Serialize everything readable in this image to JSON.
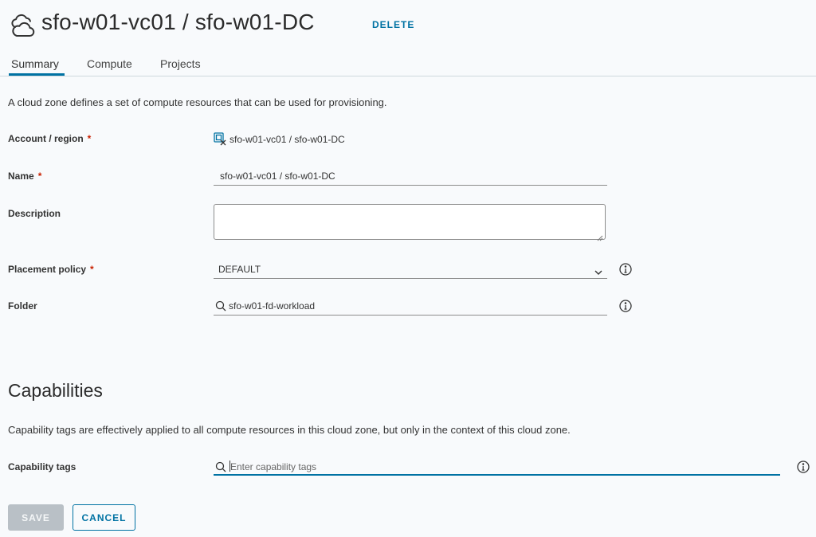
{
  "header": {
    "title": "sfo-w01-vc01 / sfo-w01-DC",
    "delete_label": "DELETE"
  },
  "tabs": [
    {
      "label": "Summary",
      "active": true
    },
    {
      "label": "Compute",
      "active": false
    },
    {
      "label": "Projects",
      "active": false
    }
  ],
  "intro": "A cloud zone defines a set of compute resources that can be used for provisioning.",
  "form": {
    "account_region": {
      "label": "Account / region",
      "required": "*",
      "value": "sfo-w01-vc01 / sfo-w01-DC",
      "icon": "vcenter-account-icon"
    },
    "name": {
      "label": "Name",
      "required": "*",
      "value": "sfo-w01-vc01 / sfo-w01-DC"
    },
    "description": {
      "label": "Description",
      "value": ""
    },
    "placement_policy": {
      "label": "Placement policy",
      "required": "*",
      "value": "DEFAULT"
    },
    "folder": {
      "label": "Folder",
      "value": "sfo-w01-fd-workload"
    }
  },
  "capabilities": {
    "title": "Capabilities",
    "description": "Capability tags are effectively applied to all compute resources in this cloud zone, but only in the context of this cloud zone.",
    "tags_label": "Capability tags",
    "tags_placeholder": "Enter capability tags"
  },
  "actions": {
    "save_label": "SAVE",
    "cancel_label": "CANCEL"
  },
  "colors": {
    "accent": "#0072a3",
    "required": "#c92100",
    "disabled_button": "#b9c0c6"
  }
}
